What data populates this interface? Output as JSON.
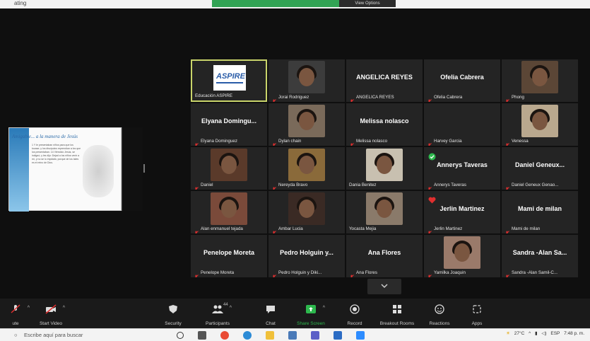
{
  "window": {
    "title": "ating"
  },
  "banner": {
    "right_label": "View Options"
  },
  "slide": {
    "title": "Amigable... a la manera de Jesús",
    "body": "1 Y le presentaban niños para que los tocase; y los discípulos reprendían a los que los presentaban. 14 Viéndolo Jesús, se indignó, y les dijo: Dejad a los niños venir a mí, y no se lo impidáis; porque de los tales es el reino de Dios."
  },
  "tiles": [
    {
      "name": "Educación ASPIRE",
      "kind": "logo",
      "logo_text": "ASPIRE",
      "active": true,
      "muted": false
    },
    {
      "name": "Jorai Rodriguez",
      "kind": "video",
      "muted": true,
      "bg": "#3c3c3c"
    },
    {
      "name": "ANGELICA REYES",
      "kind": "text",
      "big": "ANGELICA REYES",
      "muted": true
    },
    {
      "name": "Ofelia Cabrera",
      "kind": "text",
      "big": "Ofelia Cabrera",
      "muted": true
    },
    {
      "name": "Phong",
      "kind": "video",
      "muted": true,
      "bg": "#5b4636"
    },
    {
      "name": "Elyana Dominguez",
      "kind": "text",
      "big": "Elyana Domingu...",
      "muted": true
    },
    {
      "name": "Dylan chain",
      "kind": "video",
      "muted": true,
      "bg": "#7a6a5a"
    },
    {
      "name": "Melissa nolasco",
      "kind": "text",
      "big": "Melissa nolasco",
      "muted": true
    },
    {
      "name": "Harvey Garcia",
      "kind": "blank",
      "muted": true
    },
    {
      "name": "Venessa",
      "kind": "video",
      "muted": true,
      "bg": "#b9a88e"
    },
    {
      "name": "Daniel",
      "kind": "video",
      "muted": true,
      "bg": "#5a3a2a"
    },
    {
      "name": "Nereyda Bravo",
      "kind": "video",
      "muted": true,
      "bg": "#8a6a3a"
    },
    {
      "name": "Dania Benitez",
      "kind": "video",
      "muted": false,
      "bg": "#c8c0b0"
    },
    {
      "name": "Annerys Taveras",
      "kind": "text",
      "big": "Annerys Taveras",
      "muted": true,
      "badge": "check"
    },
    {
      "name": "Daniel Geneux Genao...",
      "kind": "text",
      "big": "Daniel Geneux...",
      "muted": true
    },
    {
      "name": "Alan enmanuel tejada",
      "kind": "video",
      "muted": true,
      "bg": "#7a4a3a"
    },
    {
      "name": "Ambar Lucia",
      "kind": "video",
      "muted": true,
      "bg": "#3a2a24"
    },
    {
      "name": "Yocasta Mejia",
      "kind": "video",
      "muted": false,
      "bg": "#8a7a6a"
    },
    {
      "name": "Jerlin Martinez",
      "kind": "text",
      "big": "Jerlin Martinez",
      "muted": true,
      "badge": "heart"
    },
    {
      "name": "Mami de milan",
      "kind": "text",
      "big": "Mami de milan",
      "muted": true
    },
    {
      "name": "Penelope Moreta",
      "kind": "text",
      "big": "Penelope Moreta",
      "muted": true
    },
    {
      "name": "Pedro Holguin y Diki...",
      "kind": "text",
      "big": "Pedro Holguin y...",
      "muted": true
    },
    {
      "name": "Ana Flores",
      "kind": "text",
      "big": "Ana Flores",
      "muted": true
    },
    {
      "name": "Yamilka Joaquin",
      "kind": "video",
      "muted": true,
      "bg": "#9a7a6a"
    },
    {
      "name": "Sandra -Alan Samil-C...",
      "kind": "text",
      "big": "Sandra -Alan Sa...",
      "muted": true
    }
  ],
  "toolbar": {
    "mute_label": "ute",
    "video_label": "Start Video",
    "security_label": "Security",
    "participants_label": "Participants",
    "participants_count": "44",
    "chat_label": "Chat",
    "share_label": "Share Screen",
    "record_label": "Record",
    "breakout_label": "Breakout Rooms",
    "reactions_label": "Reactions",
    "apps_label": "Apps"
  },
  "taskbar": {
    "search_placeholder": "Escribe aquí para buscar",
    "temperature": "27°C",
    "language": "ESP",
    "time": "7:48 p. m."
  },
  "colors": {
    "share_green": "#2db84d",
    "mic_red": "#e02f2f",
    "active_border": "#c9d46a"
  }
}
